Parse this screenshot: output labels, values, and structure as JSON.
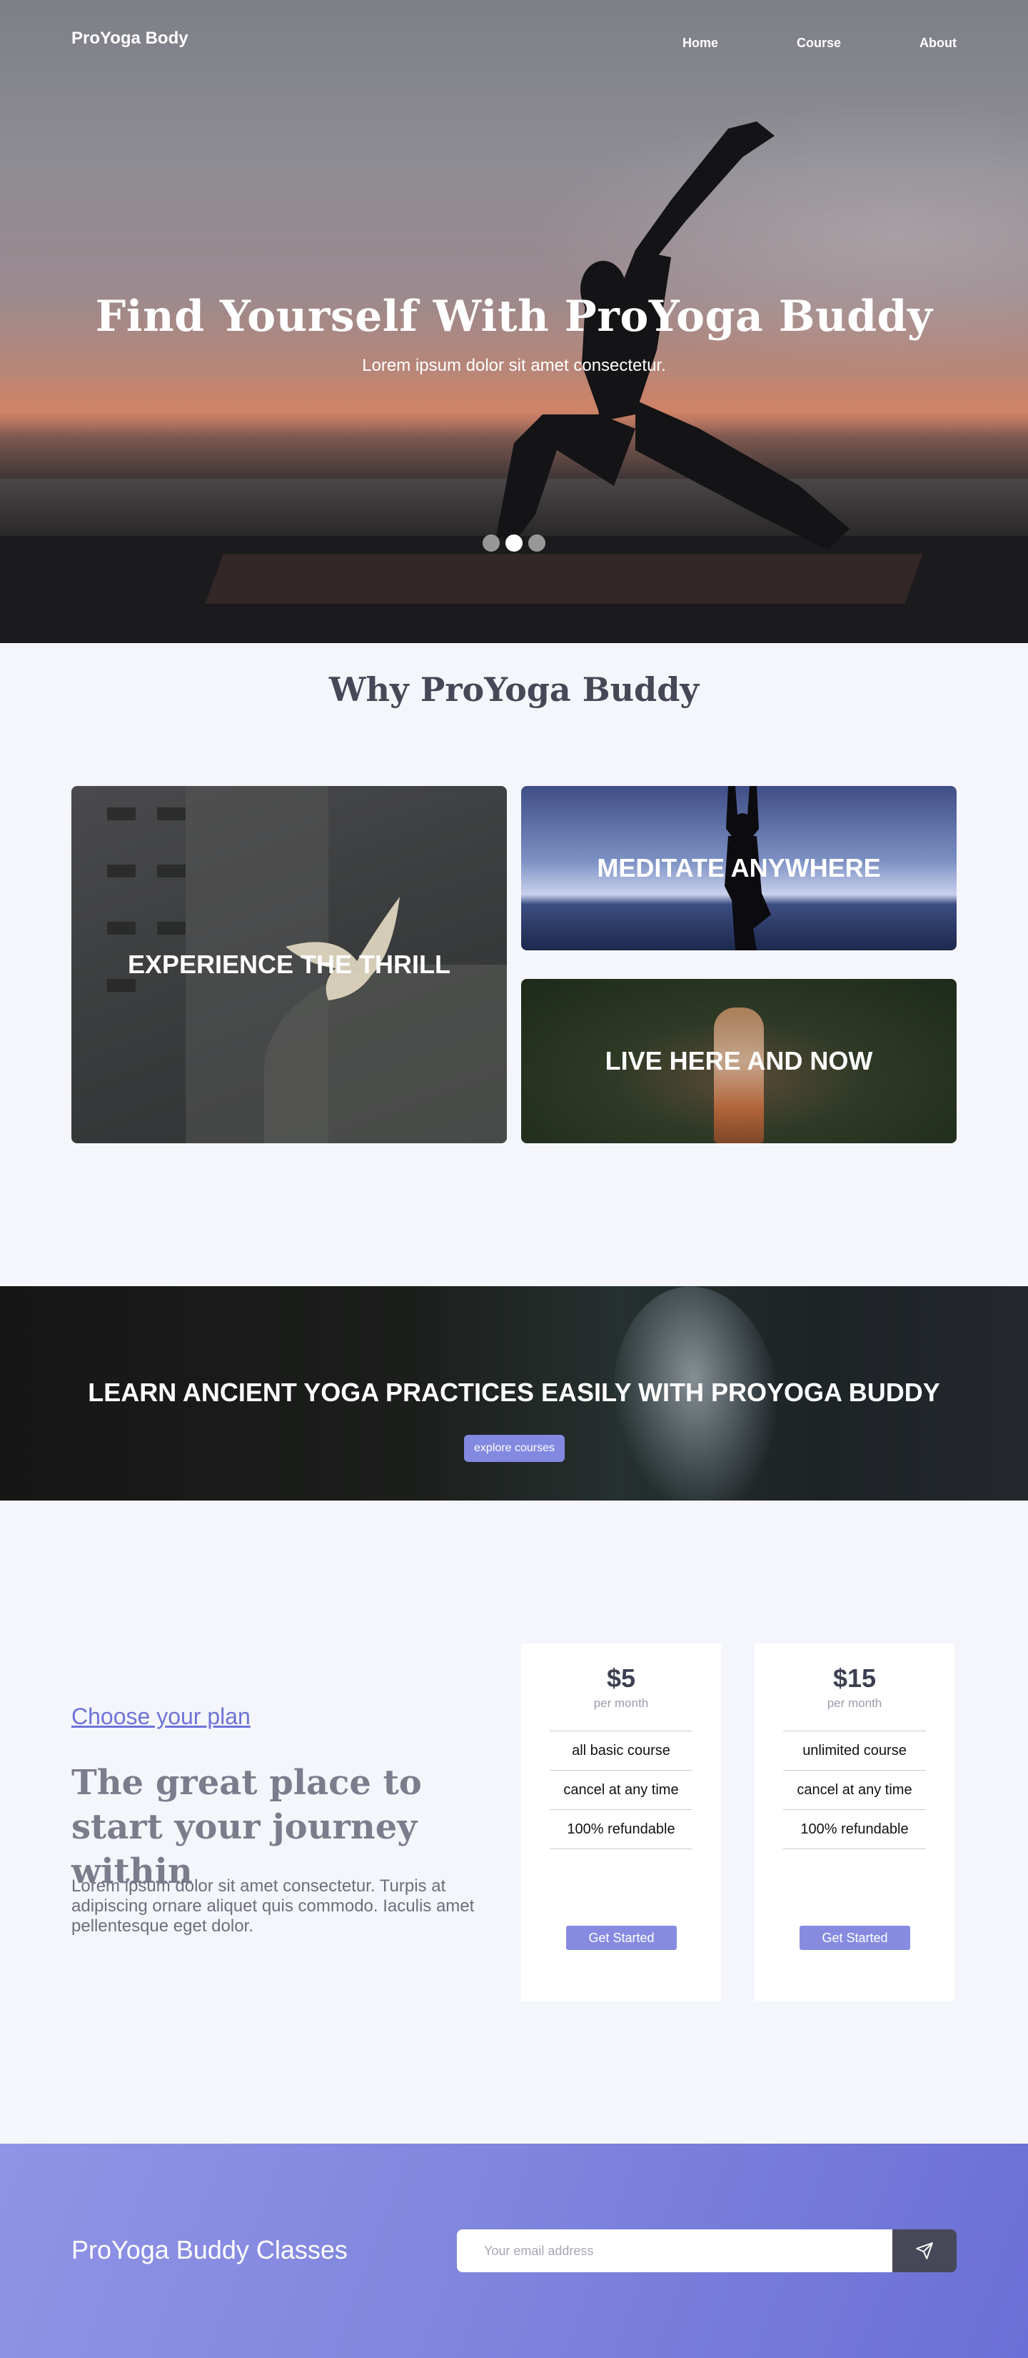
{
  "header": {
    "logo": "ProYoga Body",
    "nav": [
      "Home",
      "Course",
      "About"
    ]
  },
  "hero": {
    "title": "Find Yourself With ProYoga Buddy",
    "subtitle": "Lorem ipsum dolor sit amet consectetur.",
    "carousel_active_index": 1,
    "carousel_count": 3
  },
  "why": {
    "title": "Why ProYoga Buddy",
    "cards": [
      "EXPERIENCE THE THRILL",
      "MEDITATE ANYWHERE",
      "LIVE HERE AND NOW"
    ]
  },
  "banner": {
    "title": "LEARN ANCIENT YOGA PRACTICES EASILY WITH PROYOGA BUDDY",
    "button": "explore courses"
  },
  "plans": {
    "link": "Choose your plan",
    "title": "The great place to start your journey within",
    "text": "Lorem ipsum dolor sit amet consectetur. Turpis at adipiscing ornare aliquet quis commodo. Iaculis amet pellentesque eget dolor.",
    "cards": [
      {
        "price": "$5",
        "period": "per month",
        "features": [
          "all basic course",
          "cancel at any time",
          "100% refundable"
        ],
        "button": "Get Started"
      },
      {
        "price": "$15",
        "period": "per month",
        "features": [
          "unlimited course",
          "cancel at any time",
          "100% refundable"
        ],
        "button": "Get Started"
      }
    ]
  },
  "footer": {
    "title": "ProYoga Buddy Classes",
    "email_placeholder": "Your email address",
    "send_icon": "paper-plane-icon"
  },
  "colors": {
    "accent": "#868be0",
    "link": "#6e73d8",
    "footer_gradient_start": "#9094e6",
    "footer_gradient_end": "#6a6fd5",
    "send_button": "#464857"
  }
}
